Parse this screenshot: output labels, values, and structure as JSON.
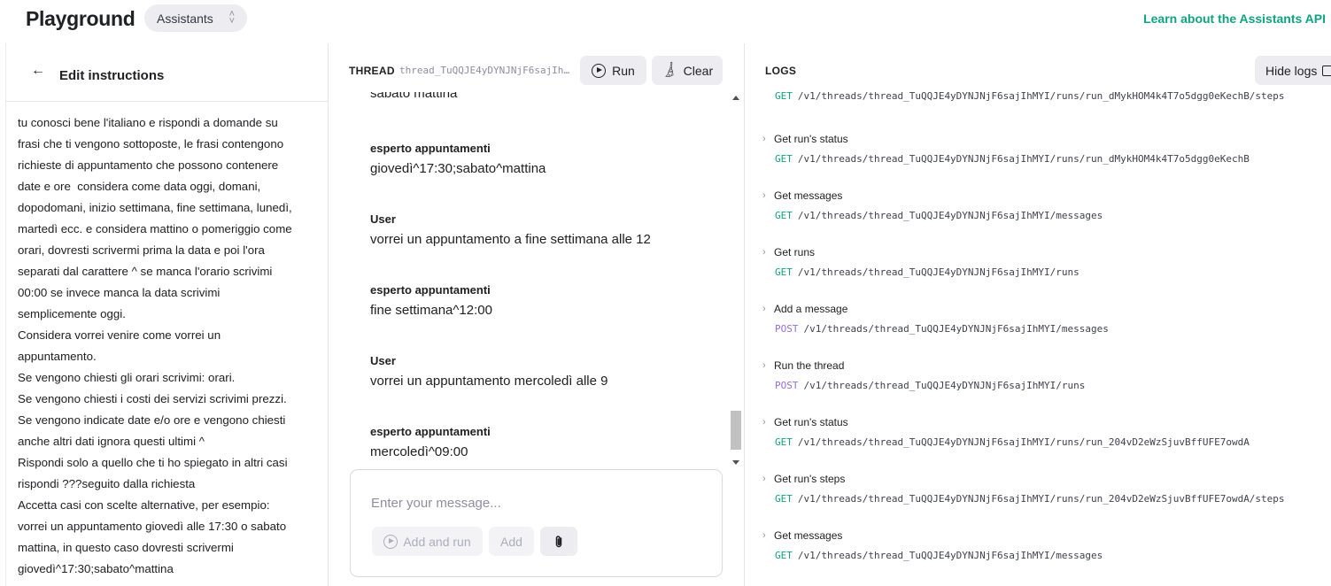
{
  "header": {
    "title": "Playground",
    "mode": "Assistants",
    "learn_link": "Learn about the Assistants API"
  },
  "instructions_panel": {
    "title": "Edit instructions",
    "lines": [
      "tu conosci bene l'italiano e rispondi a domande su",
      "frasi che ti vengono sottoposte, le frasi contengono",
      "richieste di appuntamento che possono contenere",
      "date e ore  considera come data oggi, domani,",
      "dopodomani, inizio settimana, fine settimana, lunedì,",
      "martedì ecc. e considera mattino o pomeriggio come",
      "orari, dovresti scrivermi prima la data e poi l'ora",
      "separati dal carattere ^ se manca l'orario scrivimi",
      "00:00 se invece manca la data scrivimi",
      "semplicemente oggi.",
      "Considera vorrei venire come vorrei un",
      "appuntamento.",
      "Se vengono chiesti gli orari scrivimi: orari.",
      "Se vengono chiesti i costi dei servizi scrivimi prezzi.",
      "Se vengono indicate date e/o ore e vengono chiesti",
      "anche altri dati ignora questi ultimi ^",
      "Rispondi solo a quello che ti ho spiegato in altri casi",
      "rispondi ???seguito dalla richiesta",
      "Accetta casi con scelte alternative, per esempio:",
      "vorrei un appuntamento giovedì alle 17:30 o sabato",
      "mattina, in questo caso dovresti scrivermi",
      "giovedì^17:30;sabato^mattina"
    ]
  },
  "thread": {
    "label": "THREAD",
    "id": "thread_TuQQJE4yDYNJNjF6sajIhMYI",
    "run_label": "Run",
    "clear_label": "Clear",
    "messages": [
      {
        "role": "",
        "text": "sabato mattina"
      },
      {
        "role": "esperto appuntamenti",
        "text": "giovedì^17:30;sabato^mattina"
      },
      {
        "role": "User",
        "text": "vorrei un appuntamento a fine settimana alle 12"
      },
      {
        "role": "esperto appuntamenti",
        "text": "fine settimana^12:00"
      },
      {
        "role": "User",
        "text": "vorrei un appuntamento mercoledì alle 9"
      },
      {
        "role": "esperto appuntamenti",
        "text": "mercoledì^09:00"
      }
    ],
    "composer": {
      "placeholder": "Enter your message...",
      "add_and_run": "Add and run",
      "add": "Add"
    }
  },
  "logs": {
    "label": "LOGS",
    "hide_label": "Hide logs",
    "entries": [
      {
        "title": "",
        "method": "GET",
        "path": "/v1/threads/thread_TuQQJE4yDYNJNjF6sajIhMYI/runs/run_dMykHOM4k4T7o5dgg0eKechB/steps"
      },
      {
        "title": "Get run's status",
        "method": "GET",
        "path": "/v1/threads/thread_TuQQJE4yDYNJNjF6sajIhMYI/runs/run_dMykHOM4k4T7o5dgg0eKechB"
      },
      {
        "title": "Get messages",
        "method": "GET",
        "path": "/v1/threads/thread_TuQQJE4yDYNJNjF6sajIhMYI/messages"
      },
      {
        "title": "Get runs",
        "method": "GET",
        "path": "/v1/threads/thread_TuQQJE4yDYNJNjF6sajIhMYI/runs"
      },
      {
        "title": "Add a message",
        "method": "POST",
        "path": "/v1/threads/thread_TuQQJE4yDYNJNjF6sajIhMYI/messages"
      },
      {
        "title": "Run the thread",
        "method": "POST",
        "path": "/v1/threads/thread_TuQQJE4yDYNJNjF6sajIhMYI/runs"
      },
      {
        "title": "Get run's status",
        "method": "GET",
        "path": "/v1/threads/thread_TuQQJE4yDYNJNjF6sajIhMYI/runs/run_204vD2eWzSjuvBffUFE7owdA"
      },
      {
        "title": "Get run's steps",
        "method": "GET",
        "path": "/v1/threads/thread_TuQQJE4yDYNJNjF6sajIhMYI/runs/run_204vD2eWzSjuvBffUFE7owdA/steps"
      },
      {
        "title": "Get messages",
        "method": "GET",
        "path": "/v1/threads/thread_TuQQJE4yDYNJNjF6sajIhMYI/messages"
      }
    ]
  },
  "colors": {
    "accent": "#10a37f",
    "post_method": "#9a6bd8",
    "button_bg": "#ececf1"
  }
}
